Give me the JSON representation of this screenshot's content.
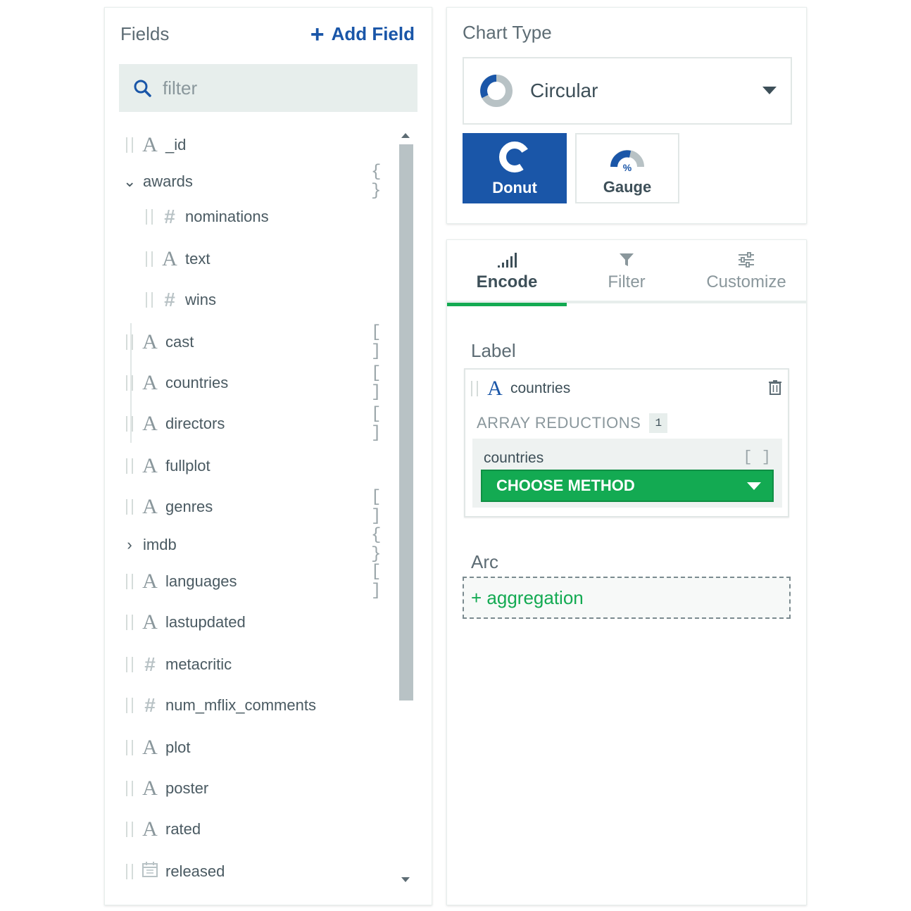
{
  "fields_panel": {
    "title": "Fields",
    "add_field_label": "Add Field",
    "add_field_plus": "+",
    "search_placeholder": "filter",
    "items": [
      {
        "name": "_id",
        "type": "A"
      },
      {
        "name": "awards",
        "type": "object",
        "badge": "{ }",
        "expanded": true
      },
      {
        "name": "nominations",
        "type": "#"
      },
      {
        "name": "text",
        "type": "A"
      },
      {
        "name": "wins",
        "type": "#"
      },
      {
        "name": "cast",
        "type": "A",
        "badge": "[ ]"
      },
      {
        "name": "countries",
        "type": "A",
        "badge": "[ ]"
      },
      {
        "name": "directors",
        "type": "A",
        "badge": "[ ]"
      },
      {
        "name": "fullplot",
        "type": "A"
      },
      {
        "name": "genres",
        "type": "A",
        "badge": "[ ]"
      },
      {
        "name": "imdb",
        "type": "object",
        "badge": "{ }",
        "expanded": false
      },
      {
        "name": "languages",
        "type": "A",
        "badge": "[ ]"
      },
      {
        "name": "lastupdated",
        "type": "A"
      },
      {
        "name": "metacritic",
        "type": "#"
      },
      {
        "name": "num_mflix_comments",
        "type": "#"
      },
      {
        "name": "plot",
        "type": "A"
      },
      {
        "name": "poster",
        "type": "A"
      },
      {
        "name": "rated",
        "type": "A"
      },
      {
        "name": "released",
        "type": "date"
      }
    ]
  },
  "chart_type": {
    "title": "Chart Type",
    "selected": "Circular",
    "options": [
      {
        "label": "Donut",
        "active": true,
        "icon": "donut-icon"
      },
      {
        "label": "Gauge",
        "active": false,
        "icon": "gauge-icon",
        "icon_text": "%"
      }
    ]
  },
  "encode_panel": {
    "tabs": [
      {
        "label": "Encode",
        "icon": "bar-signal-icon",
        "active": true
      },
      {
        "label": "Filter",
        "icon": "funnel-icon",
        "active": false
      },
      {
        "label": "Customize",
        "icon": "sliders-icon",
        "active": false
      }
    ],
    "label_section": {
      "title": "Label",
      "field": "countries",
      "field_type": "A",
      "array_reductions_label": "ARRAY REDUCTIONS",
      "array_reductions_count": "1",
      "reduction_field": "countries",
      "reduction_badge": "[ ]",
      "choose_method_label": "CHOOSE METHOD"
    },
    "arc_section": {
      "title": "Arc",
      "aggregation_label": "+ aggregation"
    }
  },
  "colors": {
    "accent_blue": "#1a56a8",
    "accent_green": "#13aa52",
    "panel_gray": "#e7eeec"
  }
}
